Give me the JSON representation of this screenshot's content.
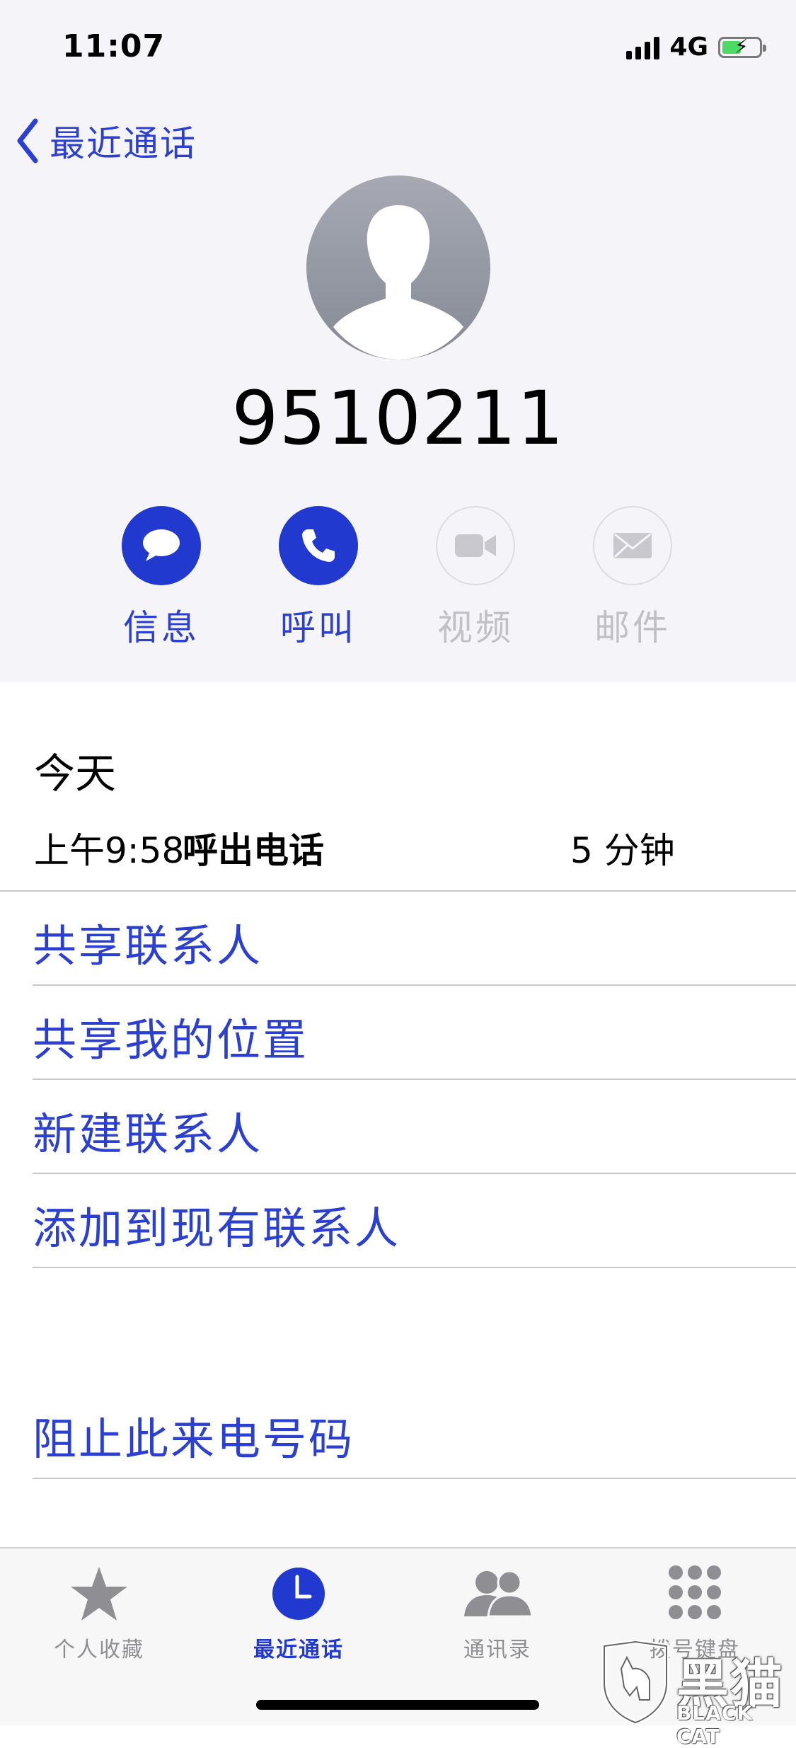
{
  "status_bar": {
    "time": "11:07",
    "network": "4G"
  },
  "nav": {
    "back_label": "最近通话"
  },
  "contact": {
    "number": "9510211"
  },
  "actions": [
    {
      "label": "信息",
      "icon": "message-bubble-icon",
      "enabled": true
    },
    {
      "label": "呼叫",
      "icon": "phone-icon",
      "enabled": true
    },
    {
      "label": "视频",
      "icon": "video-camera-icon",
      "enabled": false
    },
    {
      "label": "邮件",
      "icon": "mail-envelope-icon",
      "enabled": false
    }
  ],
  "call_log": {
    "day": "今天",
    "time": "上午9:58",
    "type": "呼出电话",
    "duration": "5 分钟"
  },
  "menu": {
    "share_contact": "共享联系人",
    "share_location": "共享我的位置",
    "new_contact": "新建联系人",
    "add_existing": "添加到现有联系人",
    "block": "阻止此来电号码"
  },
  "tabs": [
    {
      "label": "个人收藏",
      "icon": "star-icon",
      "active": false
    },
    {
      "label": "最近通话",
      "icon": "clock-icon",
      "active": true
    },
    {
      "label": "通讯录",
      "icon": "contacts-people-icon",
      "active": false
    },
    {
      "label": "拨号键盘",
      "icon": "keypad-icon",
      "active": false
    }
  ],
  "watermark": {
    "text": "黑猫",
    "sub": "BLACK CAT"
  },
  "colors": {
    "accent": "#2b3fd0",
    "disabled": "#c0c0c6",
    "header_bg": "#f5f5f9"
  }
}
